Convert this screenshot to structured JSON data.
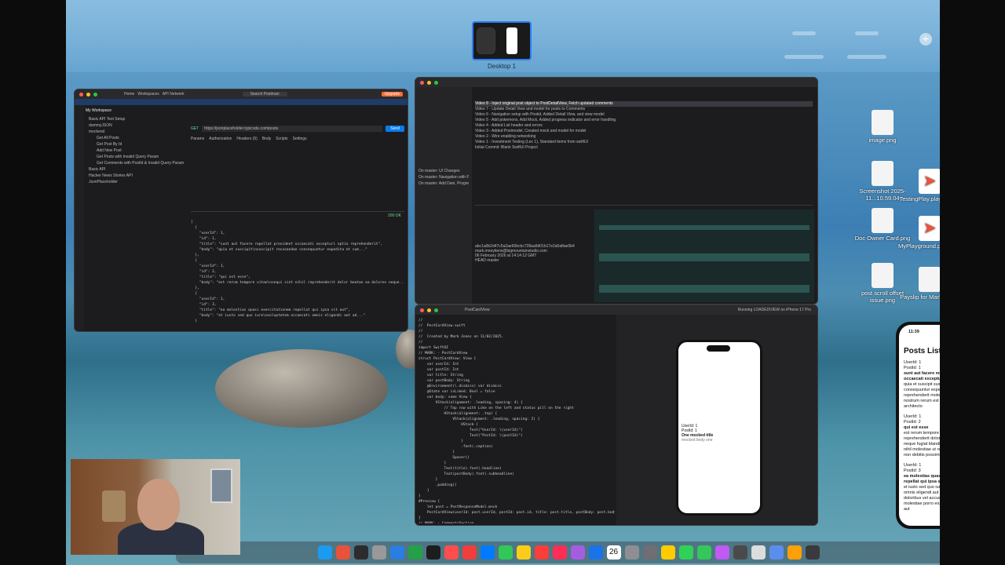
{
  "mission_control": {
    "desktop_label": "Desktop 1",
    "add_label": "+"
  },
  "postman": {
    "search_placeholder": "Search Postman",
    "upgrade_label": "Upgrade",
    "workspace_label": "My Workspace",
    "nav": [
      "Home",
      "Workspaces",
      "API Network"
    ],
    "collections": [
      "Basic API Test Setup",
      "dummyJSON",
      "mockend",
      "Get All Posts",
      "Get Post By Id",
      "Add New Post",
      "Get Posts with Invalid Query Param",
      "Get Comments with PostId & Invalid Query Param",
      "Basic API",
      "Hacker News Stories API",
      "JsonPlaceholder"
    ],
    "method": "GET",
    "url": "https://jsonplaceholder.typicode.com/posts",
    "send_label": "Send",
    "tabs": [
      "Params",
      "Authorization",
      "Headers (6)",
      "Body",
      "Scripts",
      "Settings"
    ],
    "status": "200 OK",
    "response_lines": [
      "[",
      "  {",
      "    \"userId\": 1,",
      "    \"id\": 1,",
      "    \"title\": \"sunt aut facere repellat provident occaecati excepturi optio reprehenderit\",",
      "    \"body\": \"quia et suscipit\\nsuscipit recusandae consequuntur expedita et cum...\"",
      "  },",
      "  {",
      "    \"userId\": 1,",
      "    \"id\": 2,",
      "    \"title\": \"qui est esse\",",
      "    \"body\": \"est rerum tempore vitae\\nsequi sint nihil reprehenderit dolor beatae ea dolores neque...\"",
      "  },",
      "  {",
      "    \"userId\": 1,",
      "    \"id\": 3,",
      "    \"title\": \"ea molestias quasi exercitationem repellat qui ipsa sit aut\",",
      "    \"body\": \"et iusto sed quo iure\\nvoluptatem occaecati omnis eligendi aut ad...\"",
      "  }"
    ]
  },
  "git": {
    "commits": [
      "Video 8 - Inject original post object to PostDetailView, Fetch updated comments",
      "Video 7 - Update Detail View and model for posts to Comments",
      "Video 6 - Navigation setup with Postid, Added Detail View, and view model",
      "Video 5 - Add pokemons, Add Mock, Added progress indicator and error handling",
      "Video 4 - Added List header and errors",
      "Video 3 - Added Postmodel, Created mock and model for model",
      "Video 2 - Wire enabling networking",
      "Video 1 - Investment Testing (Lec 1), Standard items from swiftUI",
      "Initial Commit: Blank SwiftUI Project"
    ],
    "branches": [
      "On master: UI Changes",
      "On master: Navigation with Parent, Post...",
      "On master: Add Dani, Progress, Empty..."
    ],
    "commit_hash": "abc1a0b2d47c5a2ae60bcbc728aa9d01b17e2a0a8ae0b4",
    "author_email": "mark.moeykens@bigmountainstudio.com",
    "date": "06 February 2026 at 14:14:12 GMT",
    "head": "HEAD master"
  },
  "xcode": {
    "file_tab": "PostCardView",
    "run_destination": "Running LOADEDVIEW on iPhone 17 Pro",
    "code_lines": [
      "//",
      "//  PostCardView.swift",
      "//",
      "//  Created by Mark Jones on 11/02/2025.",
      "//",
      "",
      "import SwiftUI",
      "",
      "// MARK: - PostCardView",
      "",
      "struct PostCardView: View {",
      "    var userId: Int",
      "    var postId: Int",
      "    var title: String",
      "    var postBody: String",
      "",
      "    @Environment(\\.dismiss) var dismiss",
      "    @State var isLiked: Bool = false",
      "",
      "    var body: some View {",
      "        VStack(alignment: .leading, spacing: 4) {",
      "            // Top row with Like on the left and status pill on the right",
      "            HStack(alignment: .top) {",
      "                VStack(alignment: .leading, spacing: 2) {",
      "                    HStack {",
      "                        Text(\"UserId: \\(userId)\")",
      "                        Text(\"PostId: \\(postId)\")",
      "                    }",
      "                    .font(.caption)",
      "                }",
      "                Spacer()",
      "            }",
      "            Text(title).font(.headline)",
      "            Text(postBody).font(.subheadline)",
      "        }",
      "        .padding()",
      "    }",
      "}",
      "",
      "#Preview {",
      "    let post = PostResponseModel.mock",
      "    PostCardView(userId: post.userId, postId: post.id, title: post.title, postBody: post.body)",
      "}",
      "",
      "// MARK: - CommentsSection",
      "",
      "struct CommentsSection: View {",
      "    let comments: [CommentResponseModel]"
    ],
    "preview_user": "UserId: 1",
    "preview_post": "PostId: 1",
    "preview_title": "One mocked title",
    "preview_body": "mocked body one"
  },
  "desktop_icons": [
    {
      "label": "image.png",
      "kind": "file"
    },
    {
      "label": "Screenshot 2025-11...10.59.04",
      "kind": "file"
    },
    {
      "label": "TestingPlay.playground",
      "kind": "swift"
    },
    {
      "label": "Doc Owner Card.png",
      "kind": "file"
    },
    {
      "label": "MyPlayground.playground",
      "kind": "swift"
    },
    {
      "label": "post scroll offset issue.png",
      "kind": "file"
    },
    {
      "label": "Payslip for Mark Jones",
      "kind": "file"
    }
  ],
  "simulator": {
    "time": "11:39",
    "title": "Posts List 📝",
    "posts": [
      {
        "user": "UserId: 1",
        "post": "PostId: 1",
        "title": "sunt aut facere repellat provident occaecati excepturi optio reprehenderit",
        "body": "quia et suscipit suscipit recusandae consequuntur expedita et cum reprehenderit molestiae ut ut quas totam nostrum rerum est autem sunt rem eveniet architecto"
      },
      {
        "user": "UserId: 1",
        "post": "PostId: 2",
        "title": "qui est esse",
        "body": "est rerum tempore vitae sequi sint nihil reprehenderit dolor beatae ea dolores neque fugiat blanditiis voluptate porro vel nihil molestiae ut reiciendis qui aperiam non debitis possimus qui neque nisi nulla"
      },
      {
        "user": "UserId: 1",
        "post": "PostId: 3",
        "title": "ea molestias quasi exercitationem repellat qui ipsa sit aut",
        "body": "et iusto sed quo iure voluptatem occaecati omnis eligendi aut ad voluptatem doloribus vel accusantium quis pariatur molestiae porro eius odio et labore et velit aut"
      }
    ]
  },
  "dock": {
    "calendar_day": "26",
    "badge": "1",
    "colors": [
      "#1b9bf0",
      "#e8513a",
      "#2c2c2e",
      "#999",
      "#2a7de1",
      "#24a148",
      "#1d1d1f",
      "#ff4d4d",
      "#f23d3d",
      "#007aff",
      "#33c759",
      "#fbcd1a",
      "#fc3d39",
      "#ff2d55",
      "#a45de0",
      "#1a73e8",
      "#0a84ff",
      "#8e8e93",
      "#6e6e73",
      "#ffcc00",
      "#30d158",
      "#34c759",
      "#bf5af2",
      "#4a4a4a",
      "#dddddd",
      "#5b8def",
      "#ff9f0a",
      "#3a3a3c"
    ]
  }
}
